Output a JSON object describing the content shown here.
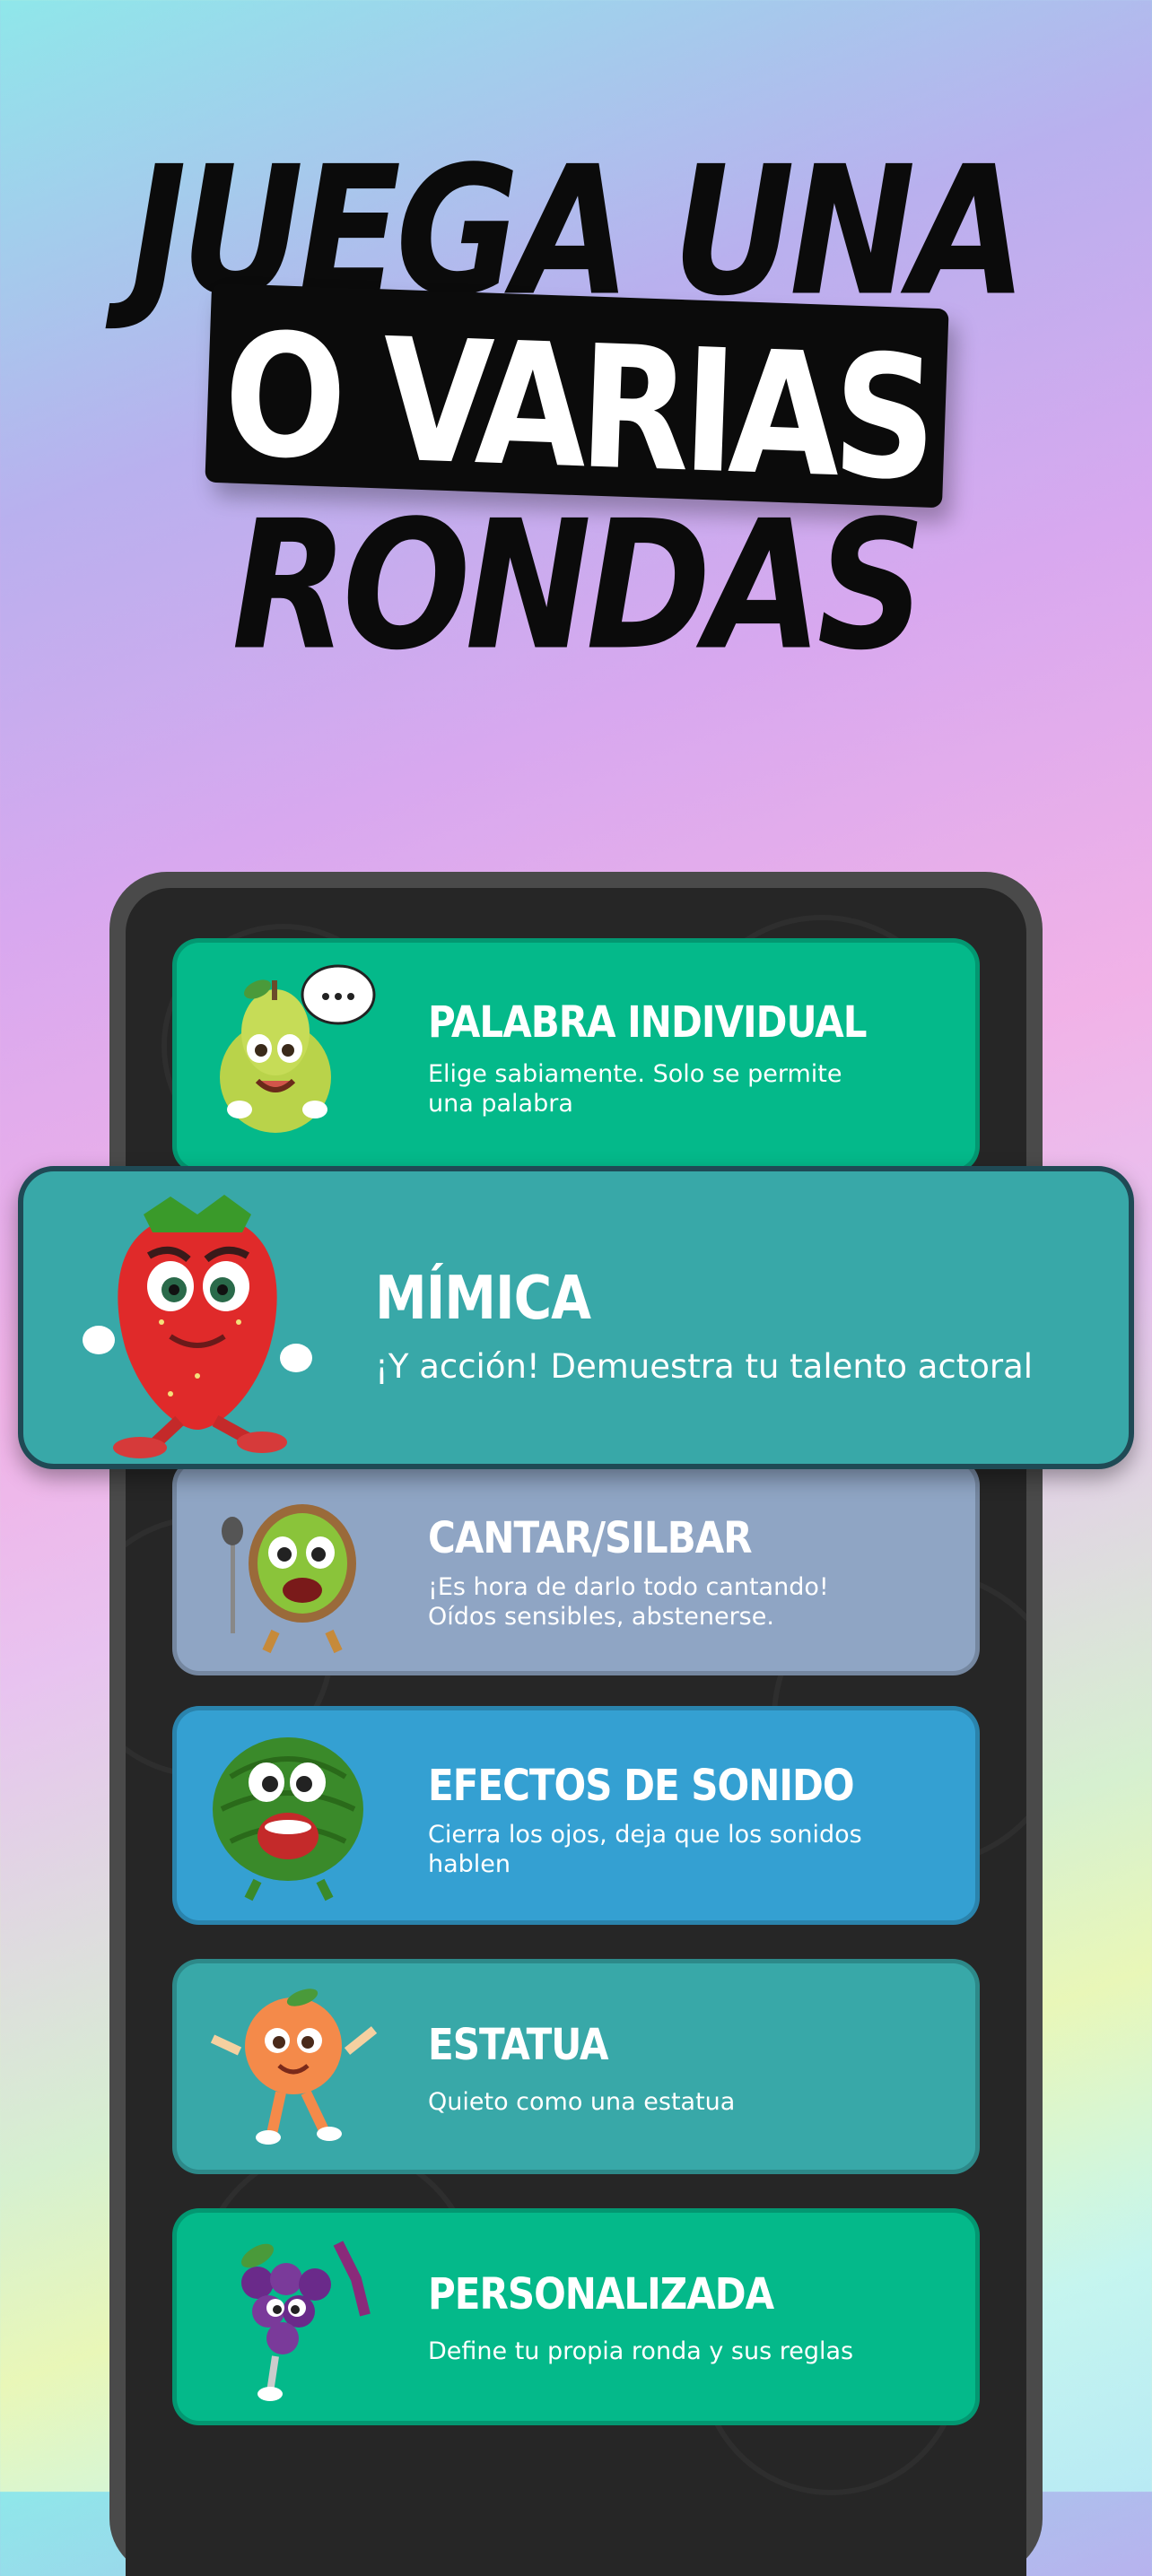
{
  "headline": {
    "line1": "JUEGA UNA",
    "line2": "O VARIAS",
    "line3": "RONDAS"
  },
  "rounds": [
    {
      "title": "PALABRA INDIVIDUAL",
      "description": "Elige sabiamente. Solo se permite una palabra",
      "character": "pear-icon",
      "color": "#04b98a"
    },
    {
      "title": "MÍMICA",
      "description": "¡Y acción! Demuestra tu talento actoral",
      "character": "strawberry-icon",
      "color": "#38a8a8"
    },
    {
      "title": "CANTAR/SILBAR",
      "description": "¡Es hora de darlo todo cantando! Oídos sensibles, abstenerse.",
      "character": "kiwi-icon",
      "color": "#8fa5c4"
    },
    {
      "title": "EFECTOS DE SONIDO",
      "description": "Cierra los ojos, deja que los sonidos hablen",
      "character": "watermelon-icon",
      "color": "#34a0d2"
    },
    {
      "title": "ESTATUA",
      "description": "Quieto como una estatua",
      "character": "peach-icon",
      "color": "#38a8a8"
    },
    {
      "title": "PERSONALIZADA",
      "description": "Define tu propia ronda y sus reglas",
      "character": "grapes-icon",
      "color": "#04b98a"
    }
  ]
}
